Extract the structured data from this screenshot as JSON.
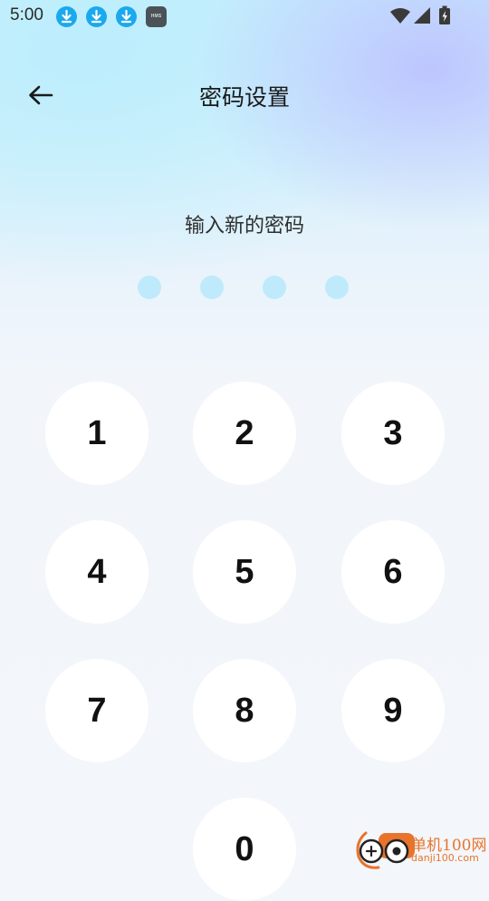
{
  "status_bar": {
    "time": "5:00",
    "notifications": [
      "download-icon",
      "download-icon",
      "download-icon",
      "hms-icon"
    ],
    "hms_label": "HMS",
    "system_icons": [
      "wifi-icon",
      "signal-icon",
      "battery-charging-icon"
    ]
  },
  "header": {
    "back_icon": "arrow-left-icon",
    "title": "密码设置"
  },
  "prompt": "输入新的密码",
  "pin": {
    "length": 4,
    "entered": 0
  },
  "keypad": {
    "keys": [
      "1",
      "2",
      "3",
      "4",
      "5",
      "6",
      "7",
      "8",
      "9",
      "0"
    ]
  },
  "watermark": {
    "title": "单机100网",
    "url": "danji100.com"
  },
  "colors": {
    "accent": "#1aa9ee",
    "pin_dot": "#bfeafc",
    "key_background": "#ffffff",
    "watermark": "#e8742c"
  }
}
